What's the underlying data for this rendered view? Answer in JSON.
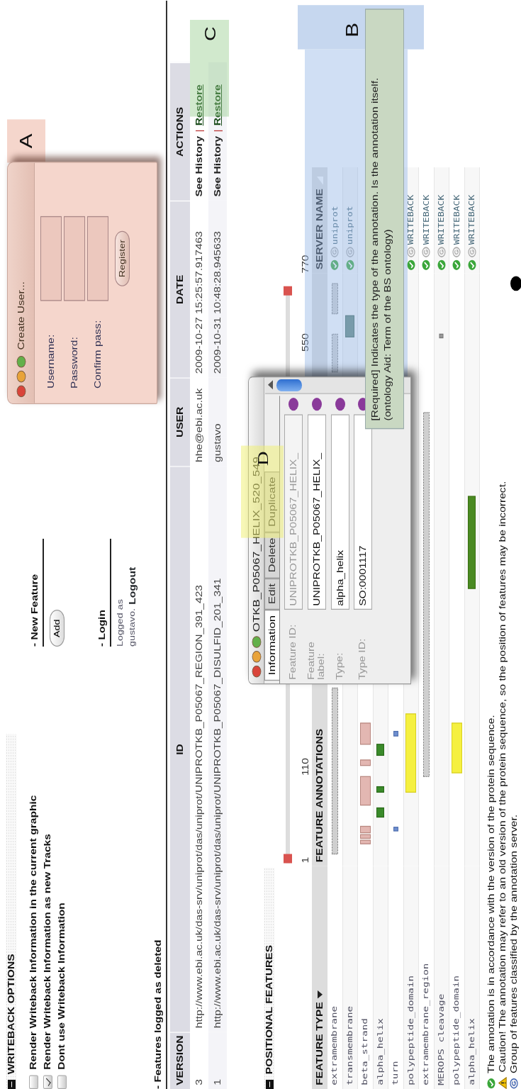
{
  "writeback_options": {
    "title": "WRITEBACK OPTIONS",
    "expanded": true,
    "options": [
      {
        "label": "Render Writeback Information in the current graphic",
        "checked": false
      },
      {
        "label": "Render Writeback Information as new Tracks",
        "checked": true
      },
      {
        "label": "Dont use Writeback Information",
        "checked": false
      }
    ]
  },
  "new_feature": {
    "title": "- New Feature",
    "button": "Add"
  },
  "login": {
    "title": "- Login",
    "status": "Logged as",
    "user": "gustavo.",
    "logout": "Logout"
  },
  "deleted_features": {
    "title": "- Features logged as deleted",
    "callout": "C",
    "columns": [
      "VERSION",
      "ID",
      "USER",
      "DATE",
      "ACTIONS"
    ],
    "rows": [
      {
        "version": "3",
        "id": "http://www.ebi.ac.uk/das-srv/uniprot/das/uniprot/UNIPROTKB_P05067_REGION_391_423",
        "user": "hhe@ebi.ac.uk",
        "date": "2009-10-27 15:25:57.917463",
        "history": "See History",
        "separator": "|",
        "restore": "Restore"
      },
      {
        "version": "1",
        "id": "http://www.ebi.ac.uk/das-srv/uniprot/das/uniprot/UNIPROTKB_P05067_DISULFID_201_341",
        "user": "gustavo",
        "date": "2009-10-31 10:48:28.945633",
        "history": "See History",
        "separator": "|",
        "restore": "Restore"
      }
    ]
  },
  "positional_features": {
    "title": "POSITIONAL FEATURES",
    "expanded": true,
    "ruler_labels": [
      "1",
      "110",
      "550",
      "770"
    ],
    "columns": [
      "FEATURE TYPE",
      "FEATURE ANNOTATIONS",
      "SERVER NAME"
    ],
    "rows": [
      {
        "type": "extramembrane",
        "server": "uniprot"
      },
      {
        "type": "transmembrane",
        "server": "uniprot"
      },
      {
        "type": "beta_strand"
      },
      {
        "type": "alpha_helix"
      },
      {
        "type": "turn"
      },
      {
        "type": "polypeptide_domain",
        "server": "WRITEBACK"
      },
      {
        "type": "extramembrane_region",
        "server": "WRITEBACK"
      },
      {
        "type": "MEROPS cleavage",
        "server": "WRITEBACK"
      },
      {
        "type": "polypeptide_domain",
        "server": "WRITEBACK"
      },
      {
        "type": "alpha_helix",
        "server": "WRITEBACK"
      }
    ]
  },
  "legend": [
    {
      "kind": "ok",
      "text": "The annotation is in accordance with the version of the protein sequence."
    },
    {
      "kind": "caution",
      "text": "Caution! The annotation may refer to an old version of the protein sequence, so the position of features may be incorrect."
    },
    {
      "kind": "group",
      "text": "Group of features classified by the annotation server."
    }
  ],
  "create_user_dialog": {
    "title": "Create User...",
    "callout": "A",
    "fields": [
      "Username:",
      "Password:",
      "Confirm pass:"
    ],
    "button": "Register"
  },
  "feature_dialog": {
    "title": "OTKB_P05067_HELIX_520_549",
    "callout": "D",
    "tabs": [
      {
        "label": "Information",
        "selected": true
      },
      {
        "label": "Edit",
        "selected": false
      },
      {
        "label": "Delete",
        "selected": false
      },
      {
        "label": "Duplicate",
        "selected": false
      }
    ],
    "fields": [
      {
        "label": "Feature ID:",
        "value": "UNIPROTKB_P05067_HELIX_",
        "disabled": true
      },
      {
        "label": "Feature label:",
        "value": "UNIPROTKB_P05067_HELIX_",
        "disabled": false
      },
      {
        "label": "Type:",
        "value": "alpha_helix",
        "disabled": false
      },
      {
        "label": "Type ID:",
        "value": "SO:0001117",
        "disabled": false
      }
    ]
  },
  "tooltip": {
    "callout": "B",
    "lines": [
      "[Required] Indicates the type of the annotation. Is the annotation itself.",
      "(ontology Aid: Term of the BS ontology)"
    ]
  }
}
